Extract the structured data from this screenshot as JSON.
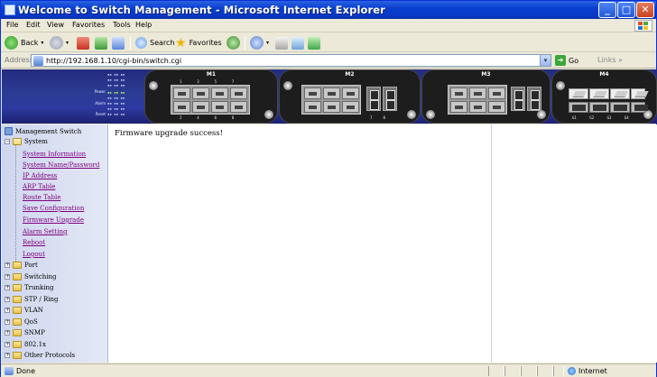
{
  "window": {
    "title": "Welcome to Switch Management - Microsoft Internet Explorer",
    "controls": {
      "min": "_",
      "max": "□",
      "close": "✕"
    }
  },
  "menu": {
    "file": "File",
    "edit": "Edit",
    "view": "View",
    "favorites": "Favorites",
    "tools": "Tools",
    "help": "Help"
  },
  "toolbar": {
    "back": "Back",
    "search": "Search",
    "favorites": "Favorites"
  },
  "address": {
    "label": "Address",
    "url": "http://192.168.1.10/cgi-bin/switch.cgi",
    "go": "Go",
    "links": "Links"
  },
  "banner": {
    "modules": [
      "M1",
      "M2",
      "M3",
      "M4"
    ],
    "led_labels": [
      "Power",
      "Alarm",
      "Reset"
    ],
    "m4_port_numbers": [
      "G1",
      "G2",
      "G3",
      "G4"
    ],
    "rj45_numbers_top": [
      "1",
      "3",
      "5",
      "7"
    ],
    "rj45_numbers_bottom": [
      "2",
      "4",
      "6",
      "8"
    ],
    "fiber_numbers": [
      "7",
      "8"
    ]
  },
  "sidebar": {
    "root": "Management Switch",
    "system": "System",
    "system_items": [
      "System Information",
      "System Name/Password",
      "IP Address",
      "ARP Table",
      "Route Table",
      "Save Configuration",
      "Firmware Upgrade",
      "Alarm Setting",
      "Reboot",
      "Logout"
    ],
    "folders": [
      "Port",
      "Switching",
      "Trunking",
      "STP / Ring",
      "VLAN",
      "QoS",
      "SNMP",
      "802.1x",
      "Other Protocols"
    ]
  },
  "main": {
    "message": "Firmware upgrade success!"
  },
  "status": {
    "text": "Done",
    "zone": "Internet"
  }
}
